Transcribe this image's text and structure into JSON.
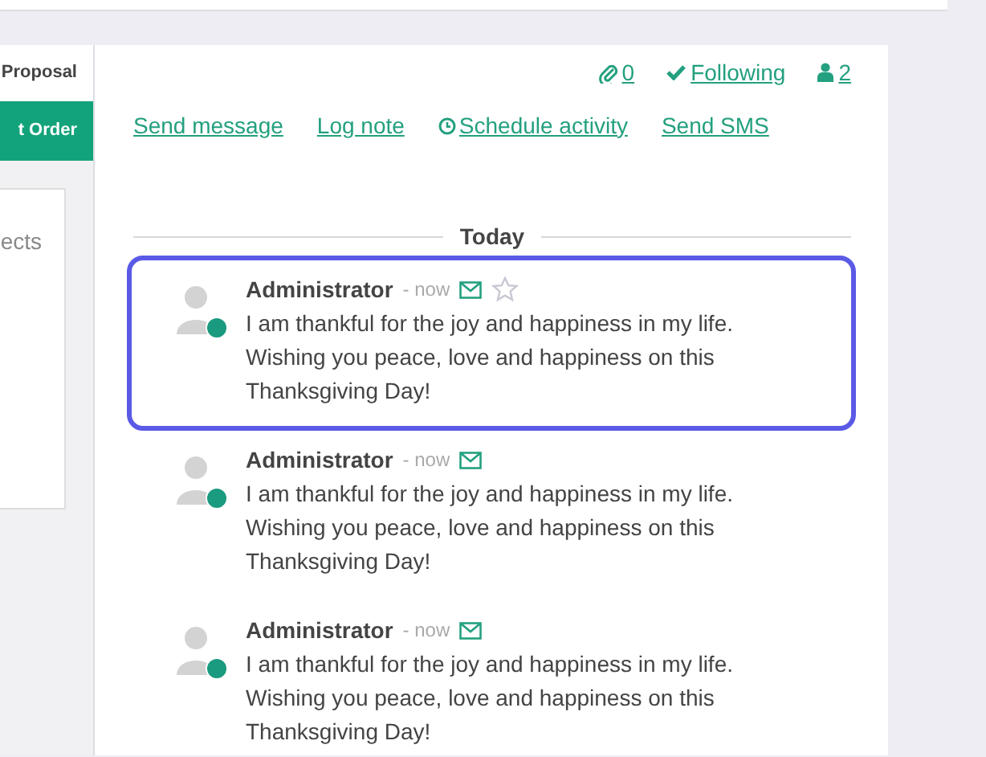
{
  "side": {
    "proposal_label": "Proposal",
    "order_button": "t Order",
    "panel_text": "ects"
  },
  "header": {
    "attachments": "0",
    "follow": {
      "label": "Following",
      "following": true
    },
    "followers": "2"
  },
  "actions": [
    {
      "label": "Send message",
      "kind": "plain"
    },
    {
      "label": "Log note",
      "kind": "plain"
    },
    {
      "label": "Schedule activity",
      "kind": "clock"
    },
    {
      "label": "Send SMS",
      "kind": "plain"
    }
  ],
  "divider": "Today",
  "messages": [
    {
      "author": "Administrator",
      "time": "- now",
      "body": "I am thankful for the joy and happiness in my life. Wishing you peace, love and happiness on this Thanksgiving Day!",
      "selected": true,
      "online": true
    },
    {
      "author": "Administrator",
      "time": "- now",
      "body": "I am thankful for the joy and happiness in my life. Wishing you peace, love and happiness on this Thanksgiving Day!",
      "selected": false,
      "online": true
    },
    {
      "author": "Administrator",
      "time": "- now",
      "body": "I am thankful for the joy and happiness in my life. Wishing you peace, love and happiness on this Thanksgiving Day!",
      "selected": false,
      "online": true
    }
  ]
}
